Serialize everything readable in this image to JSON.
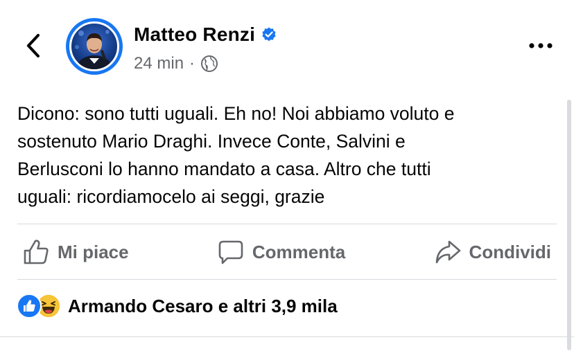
{
  "header": {
    "back_icon": "chevron-left-icon",
    "author_name": "Matteo Renzi",
    "verified_icon": "verified-badge-icon",
    "time": "24 min",
    "separator": "·",
    "audience_icon": "globe-icon",
    "more_icon": "more-horizontal-icon"
  },
  "post": {
    "text": "Dicono: sono tutti uguali. Eh no! Noi abbiamo voluto e\nsostenuto Mario Draghi. Invece Conte, Salvini e\nBerlusconi lo hanno mandato a casa. Altro che tutti\nuguali: ricordiamocelo ai seggi, grazie"
  },
  "actions": {
    "like_label": "Mi piace",
    "comment_label": "Commenta",
    "share_label": "Condividi"
  },
  "reactions": {
    "summary": "Armando Cesaro e altri 3,9 mila",
    "types": [
      "like",
      "haha"
    ]
  },
  "colors": {
    "accent": "#1877f2",
    "secondary_text": "#65676b",
    "divider": "#d7d9dd",
    "haha": "#f7b928"
  }
}
